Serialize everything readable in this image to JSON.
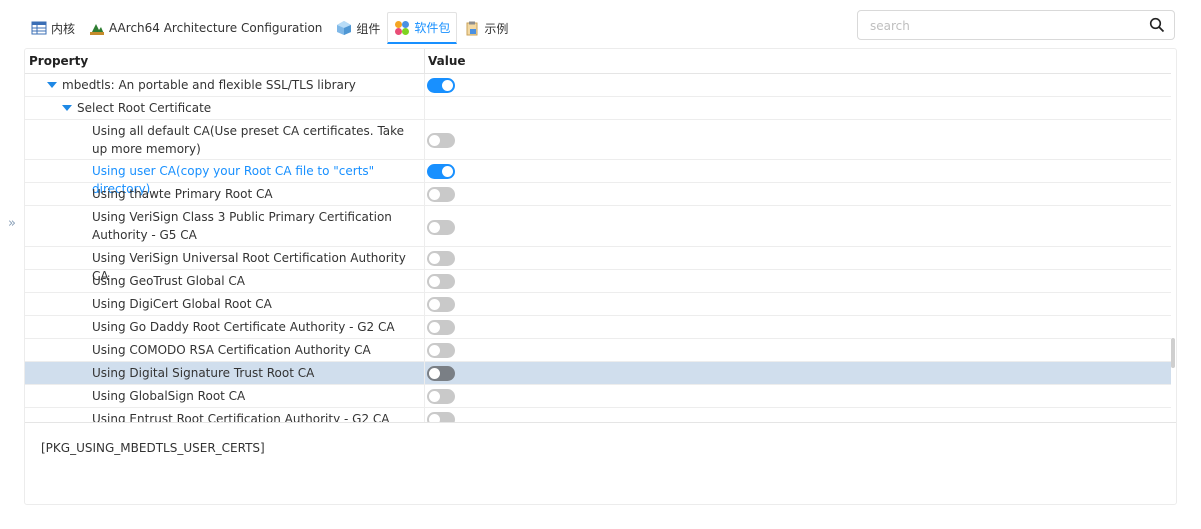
{
  "tabs": [
    {
      "label": "内核",
      "icon": "table-icon"
    },
    {
      "label": "AArch64 Architecture Configuration",
      "icon": "chip-icon"
    },
    {
      "label": "组件",
      "icon": "cube-icon"
    },
    {
      "label": "软件包",
      "icon": "packages-icon",
      "active": true
    },
    {
      "label": "示例",
      "icon": "clipboard-icon"
    }
  ],
  "search": {
    "placeholder": "search",
    "value": ""
  },
  "table": {
    "col_property": "Property",
    "col_value": "Value",
    "rows": [
      {
        "label": "mbedtls: An portable and flexible SSL/TLS library",
        "toggle": "on"
      },
      {
        "label": "Select Root Certificate"
      },
      {
        "label": "Using all default CA(Use preset CA certificates. Take up more memory)",
        "toggle": "off"
      },
      {
        "label": "Using user CA(copy your Root CA file to \"certs\" directory)",
        "toggle": "on"
      },
      {
        "label": "Using thawte Primary Root CA",
        "toggle": "off"
      },
      {
        "label": "Using VeriSign Class 3 Public Primary Certification Authority - G5 CA",
        "toggle": "off"
      },
      {
        "label": "Using VeriSign Universal Root Certification Authority CA",
        "toggle": "off"
      },
      {
        "label": "Using GeoTrust Global CA",
        "toggle": "off"
      },
      {
        "label": "Using DigiCert Global Root CA",
        "toggle": "off"
      },
      {
        "label": "Using Go Daddy Root Certificate Authority - G2 CA",
        "toggle": "off"
      },
      {
        "label": "Using COMODO RSA Certification Authority CA",
        "toggle": "off"
      },
      {
        "label": "Using Digital Signature Trust Root CA",
        "toggle": "off",
        "selected": true
      },
      {
        "label": "Using GlobalSign Root CA",
        "toggle": "off"
      },
      {
        "label": "Using Entrust Root Certification Authority - G2 CA",
        "toggle": "off"
      }
    ]
  },
  "description": "[PKG_USING_MBEDTLS_USER_CERTS]",
  "colors": {
    "accent": "#1890ff",
    "selected_row": "#d0deed",
    "toggle_off": "#c9c9c9"
  }
}
